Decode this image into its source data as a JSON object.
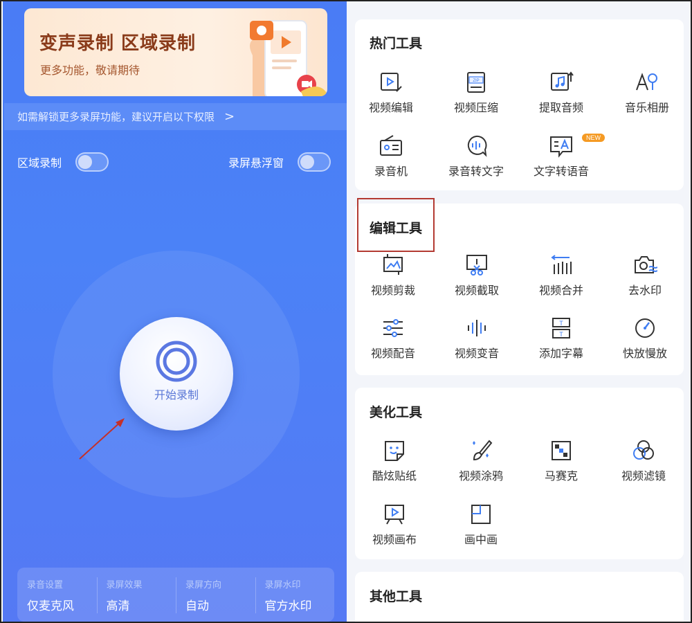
{
  "banner": {
    "title": "变声录制 区域录制",
    "subtitle": "更多功能，敬请期待"
  },
  "permission_tip": {
    "text": "如需解锁更多录屏功能，建议开启以下权限",
    "chevron": ">"
  },
  "toggles": [
    {
      "label": "区域录制",
      "on": false
    },
    {
      "label": "录屏悬浮窗",
      "on": false
    }
  ],
  "record_button": {
    "label": "开始录制"
  },
  "settings": [
    {
      "label": "录音设置",
      "value": "仅麦克风"
    },
    {
      "label": "录屏效果",
      "value": "高清"
    },
    {
      "label": "录屏方向",
      "value": "自动"
    },
    {
      "label": "录屏水印",
      "value": "官方水印"
    }
  ],
  "sections": {
    "hot": {
      "title": "热门工具",
      "items": [
        {
          "label": "视频编辑",
          "icon": "video-edit-icon"
        },
        {
          "label": "视频压缩",
          "icon": "zip-icon",
          "icon_text": "ZIP"
        },
        {
          "label": "提取音频",
          "icon": "music-extract-icon"
        },
        {
          "label": "音乐相册",
          "icon": "music-album-icon"
        },
        {
          "label": "录音机",
          "icon": "radio-icon"
        },
        {
          "label": "录音转文字",
          "icon": "speech-to-text-icon"
        },
        {
          "label": "文字转语音",
          "icon": "text-to-speech-icon",
          "badge": "NEW"
        }
      ]
    },
    "edit": {
      "title": "编辑工具",
      "items": [
        {
          "label": "视频剪裁",
          "icon": "crop-icon"
        },
        {
          "label": "视频截取",
          "icon": "cut-icon"
        },
        {
          "label": "视频合并",
          "icon": "merge-icon"
        },
        {
          "label": "去水印",
          "icon": "remove-watermark-icon"
        },
        {
          "label": "视频配音",
          "icon": "sliders-icon"
        },
        {
          "label": "视频变音",
          "icon": "waveform-icon"
        },
        {
          "label": "添加字幕",
          "icon": "subtitle-icon",
          "icon_text": "T"
        },
        {
          "label": "快放慢放",
          "icon": "speed-icon"
        }
      ]
    },
    "beauty": {
      "title": "美化工具",
      "items": [
        {
          "label": "酷炫贴纸",
          "icon": "sticker-icon"
        },
        {
          "label": "视频涂鸦",
          "icon": "brush-icon"
        },
        {
          "label": "马赛克",
          "icon": "mosaic-icon"
        },
        {
          "label": "视频滤镜",
          "icon": "filter-icon"
        },
        {
          "label": "视频画布",
          "icon": "canvas-icon"
        },
        {
          "label": "画中画",
          "icon": "pip-icon"
        }
      ]
    },
    "other": {
      "title": "其他工具"
    }
  },
  "colors": {
    "left_bg": "#4b7ff6",
    "accent_blue": "#3f7df2",
    "badge_orange": "#f59a23",
    "highlight_red": "#b33a32"
  }
}
